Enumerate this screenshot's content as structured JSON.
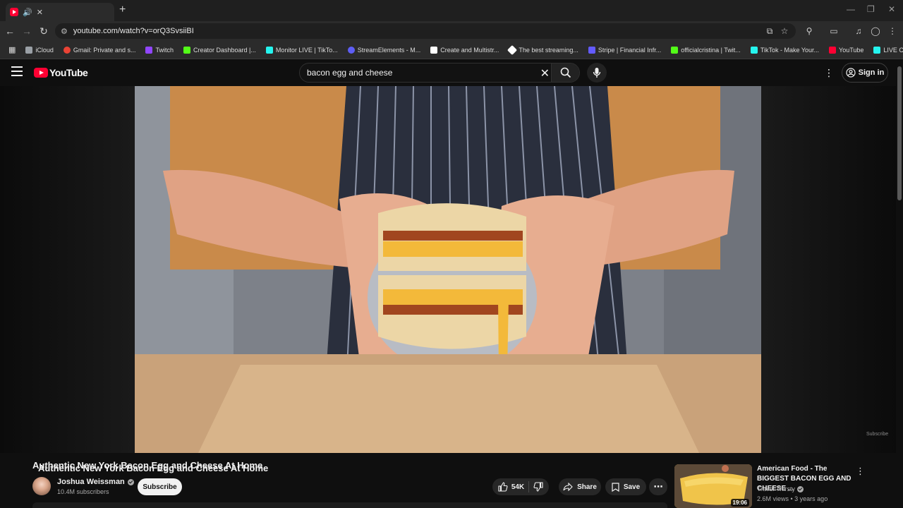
{
  "browser": {
    "tab_title": "Authentic New York Bacon Egg and Cheese At Home",
    "url": "youtube.com/watch?v=orQ3SvsiiBI",
    "bookmarks": [
      {
        "label": "iCloud",
        "color": "#9aa0a6"
      },
      {
        "label": "Gmail: Private and s...",
        "color": "#ea4335"
      },
      {
        "label": "Twitch",
        "color": "#9146ff"
      },
      {
        "label": "Creator Dashboard |...",
        "color": "#53fc18"
      },
      {
        "label": "Monitor LIVE | TikTo...",
        "color": "#25f4ee"
      },
      {
        "label": "StreamElements - M...",
        "color": "#5e5ef5"
      },
      {
        "label": "Create and Multistr...",
        "color": "#ffffff"
      },
      {
        "label": "The best streaming...",
        "color": "#ffffff"
      },
      {
        "label": "Stripe | Financial Infr...",
        "color": "#635bff"
      },
      {
        "label": "officialcristina | Twit...",
        "color": "#53fc18"
      },
      {
        "label": "TikTok - Make Your...",
        "color": "#25f4ee"
      },
      {
        "label": "YouTube",
        "color": "#ff0033"
      },
      {
        "label": "LIVE Center",
        "color": "#25f4ee"
      }
    ]
  },
  "yt": {
    "logo_text": "YouTube",
    "search_value": "bacon egg and cheese",
    "signin_label": "Sign in"
  },
  "video": {
    "title": "Authentic New York Bacon Egg and Cheese At Home",
    "channel": "Joshua Weissman",
    "subscribers": "10.4M subscribers",
    "subscribe_label": "Subscribe",
    "likes": "54K",
    "share_label": "Share",
    "save_label": "Save",
    "watermark": "Subscribe"
  },
  "recommended": {
    "title": "American Food - The BIGGEST BACON EGG AND CHEESE ...",
    "channel": "Travel Thirsty",
    "meta": "2.6M views • 3 years ago",
    "duration": "19:06"
  }
}
